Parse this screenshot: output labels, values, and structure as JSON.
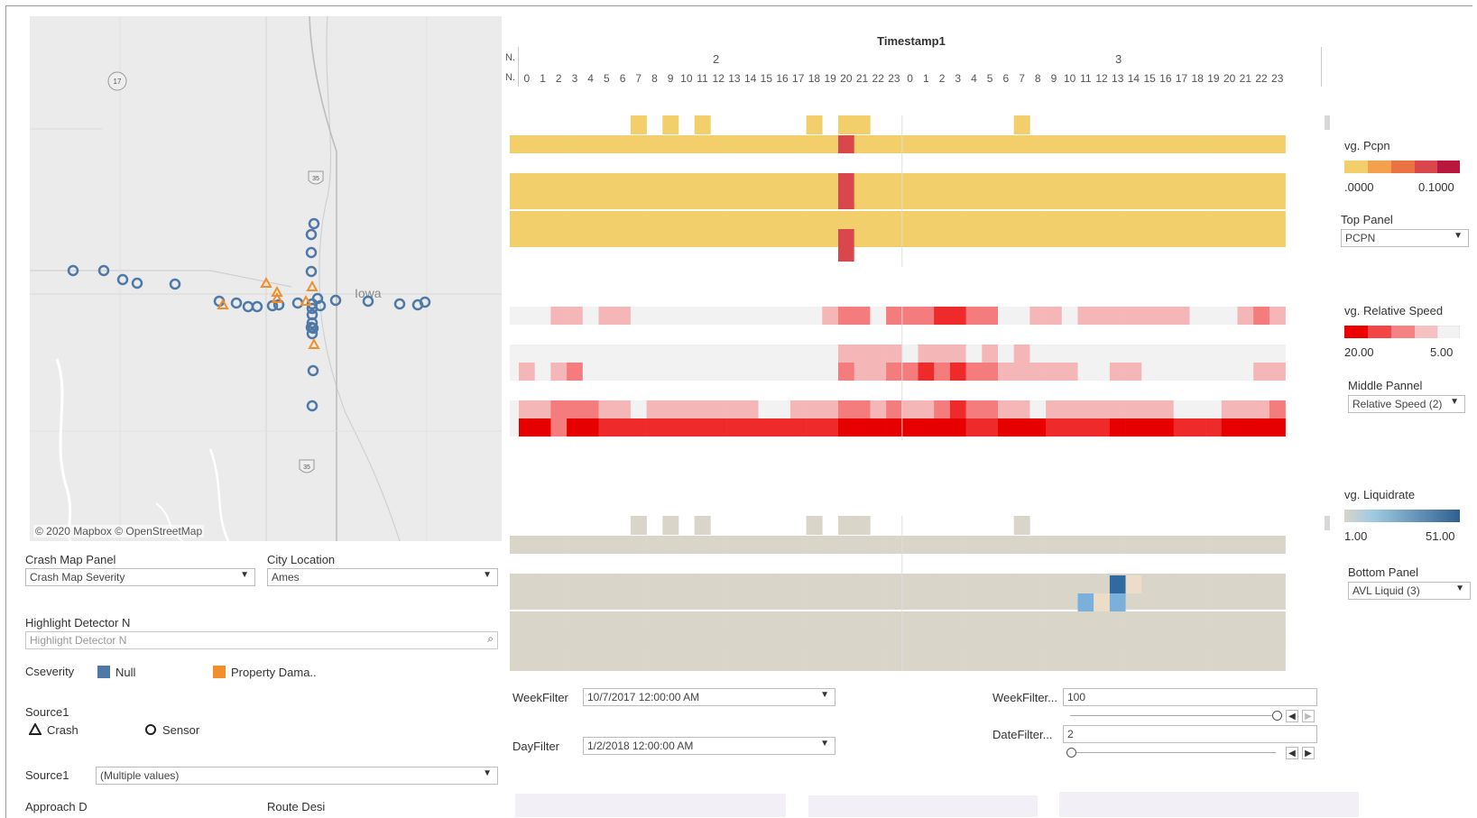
{
  "map": {
    "attribution": "© 2020 Mapbox © OpenStreetMap",
    "place_label": "Iowa",
    "highway_shields": [
      "17",
      "35",
      "35"
    ]
  },
  "controls": {
    "crash_map_panel": {
      "label": "Crash Map Panel",
      "value": "Crash Map Severity"
    },
    "city_location": {
      "label": "City Location",
      "value": "Ames"
    },
    "highlight_detector": {
      "label": "Highlight Detector N",
      "placeholder": "Highlight Detector N"
    },
    "cseverity": {
      "label": "Cseverity",
      "items": [
        {
          "name": "Null",
          "color": "#4e79a7"
        },
        {
          "name": "Property Dama..",
          "color": "#f28e2b"
        }
      ]
    },
    "source_legend": {
      "label": "Source1",
      "items": [
        "Crash",
        "Sensor"
      ]
    },
    "source_filter": {
      "label": "Source1",
      "value": "(Multiple values)"
    },
    "approach": {
      "label": "Approach D"
    },
    "route": {
      "label": "Route Desi"
    }
  },
  "chart": {
    "title": "Timestamp1",
    "day_labels": [
      "2",
      "3"
    ],
    "edge_label": "N.",
    "hours": [
      "0",
      "1",
      "2",
      "3",
      "4",
      "5",
      "6",
      "7",
      "8",
      "9",
      "10",
      "11",
      "12",
      "13",
      "14",
      "15",
      "16",
      "17",
      "18",
      "19",
      "20",
      "21",
      "22",
      "23"
    ]
  },
  "legends": {
    "top": {
      "title": "vg. Pcpn",
      "min": ".0000",
      "max": "0.1000",
      "panel_label": "Top Panel",
      "panel_value": "PCPN"
    },
    "middle": {
      "title": "vg. Relative Speed",
      "min": "20.00",
      "max": "5.00",
      "panel_label": "Middle Pannel",
      "panel_value": "Relative Speed (2)"
    },
    "bottom": {
      "title": "vg. Liquidrate",
      "min": "1.00",
      "max": "51.00",
      "panel_label": "Bottom Panel",
      "panel_value": "AVL Liquid (3)"
    }
  },
  "filters": {
    "week": {
      "label": "WeekFilter",
      "value": "10/7/2017 12:00:00 AM"
    },
    "day": {
      "label": "DayFilter",
      "value": "1/2/2018 12:00:00 AM"
    },
    "week2": {
      "label": "WeekFilter...",
      "value": "100"
    },
    "date2": {
      "label": "DateFilter...",
      "value": "2"
    }
  },
  "colors": {
    "pcpn_base": "#f2cf6b",
    "pcpn_high": "#d9474c",
    "speed_light": "#f2f2f2",
    "speed_pink": "#f4b6b6",
    "speed_mid": "#f47c7c",
    "speed_red": "#ef2a2a",
    "speed_darkred": "#e60000",
    "liquid_base": "#d9d5c9",
    "liquid_dark": "#2f6aa0",
    "liquid_light": "#7bb0da",
    "liquid_tan": "#ecdcc8"
  },
  "chart_data": {
    "type": "heatmap",
    "x": [
      "2-0",
      "2-1",
      "2-2",
      "2-3",
      "2-4",
      "2-5",
      "2-6",
      "2-7",
      "2-8",
      "2-9",
      "2-10",
      "2-11",
      "2-12",
      "2-13",
      "2-14",
      "2-15",
      "2-16",
      "2-17",
      "2-18",
      "2-19",
      "2-20",
      "2-21",
      "2-22",
      "2-23",
      "3-0",
      "3-1",
      "3-2",
      "3-3",
      "3-4",
      "3-5",
      "3-6",
      "3-7",
      "3-8",
      "3-9",
      "3-10",
      "3-11",
      "3-12",
      "3-13",
      "3-14",
      "3-15",
      "3-16",
      "3-17",
      "3-18",
      "3-19",
      "3-20",
      "3-21",
      "3-22",
      "3-23"
    ],
    "panels": [
      {
        "name": "Avg. Pcpn",
        "high_cells": [
          [
            1,
            20
          ],
          [
            3,
            20
          ],
          [
            5,
            20
          ]
        ]
      },
      {
        "name": "Avg. Relative Speed"
      },
      {
        "name": "Avg. Liquidrate",
        "colored_cells": [
          [
            2,
            37,
            "dark"
          ],
          [
            3,
            35,
            "light"
          ],
          [
            3,
            36,
            "tan"
          ],
          [
            3,
            37,
            "light"
          ],
          [
            2,
            38,
            "tan"
          ]
        ]
      }
    ]
  }
}
